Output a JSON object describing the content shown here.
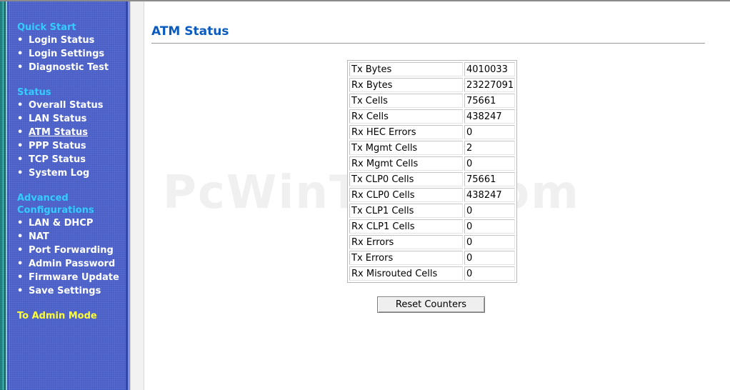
{
  "sidebar": {
    "quick_start": {
      "heading": "Quick Start",
      "items": [
        "Login Status",
        "Login Settings",
        "Diagnostic Test"
      ]
    },
    "status": {
      "heading": "Status",
      "items": [
        "Overall Status",
        "LAN Status",
        "ATM Status",
        "PPP Status",
        "TCP Status",
        "System Log"
      ],
      "active": "ATM Status"
    },
    "advanced": {
      "heading_line1": "Advanced",
      "heading_line2": "Configurations",
      "items": [
        "LAN & DHCP",
        "NAT",
        "Port Forwarding",
        "Admin Password",
        "Firmware Update",
        "Save Settings"
      ]
    },
    "admin_mode": "To Admin Mode",
    "bullet": "•"
  },
  "main": {
    "title": "ATM Status",
    "stats": [
      {
        "label": "Tx Bytes",
        "value": "4010033"
      },
      {
        "label": "Rx Bytes",
        "value": "23227091"
      },
      {
        "label": "Tx Cells",
        "value": "75661"
      },
      {
        "label": "Rx Cells",
        "value": "438247"
      },
      {
        "label": "Rx HEC Errors",
        "value": "0"
      },
      {
        "label": "Tx Mgmt Cells",
        "value": "2"
      },
      {
        "label": "Rx Mgmt Cells",
        "value": "0"
      },
      {
        "label": "Tx CLP0 Cells",
        "value": "75661"
      },
      {
        "label": "Rx CLP0 Cells",
        "value": "438247"
      },
      {
        "label": "Tx CLP1 Cells",
        "value": "0"
      },
      {
        "label": "Rx CLP1 Cells",
        "value": "0"
      },
      {
        "label": "Rx Errors",
        "value": "0"
      },
      {
        "label": "Tx Errors",
        "value": "0"
      },
      {
        "label": "Rx Misrouted Cells",
        "value": "0"
      }
    ],
    "reset_label": "Reset Counters"
  },
  "watermark": "PcWinTech.com",
  "colors": {
    "sidebar_bg": "#4a5fc8",
    "menu_heading": "#33ccff",
    "menu_item": "#ffffff",
    "admin_link": "#ffff33",
    "title": "#0b5bbf"
  }
}
